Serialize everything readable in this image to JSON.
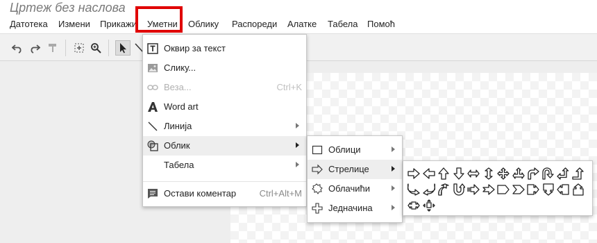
{
  "doc_title": "Цртеж без наслова",
  "menubar": [
    "Датотека",
    "Измени",
    "Прикажи",
    "Уметни",
    "Облику",
    "Распореди",
    "Алатке",
    "Табела",
    "Помоћ"
  ],
  "insert_menu": {
    "text_box": "Оквир за текст",
    "image": "Слику...",
    "link": "Веза...",
    "link_shortcut": "Ctrl+K",
    "word_art": "Word art",
    "line": "Линија",
    "shape": "Облик",
    "table": "Табела",
    "comment": "Остави коментар",
    "comment_shortcut": "Ctrl+Alt+M"
  },
  "shape_submenu": {
    "shapes": "Облици",
    "arrows": "Стрелице",
    "callouts": "Облачићи",
    "equations": "Једначина"
  },
  "arrow_shapes": [
    "right-arrow-icon",
    "left-arrow-icon",
    "up-arrow-icon",
    "down-arrow-icon",
    "left-right-arrow-icon",
    "up-down-arrow-icon",
    "quad-arrow-icon",
    "left-right-up-arrow-icon",
    "bent-arrow-icon",
    "u-turn-arrow-icon",
    "left-up-arrow-icon",
    "bent-up-arrow-icon",
    "curved-right-arrow-icon",
    "curved-left-arrow-icon",
    "curved-up-arrow-icon",
    "curved-down-arrow-icon",
    "striped-right-arrow-icon",
    "notched-right-arrow-icon",
    "pentagon-arrow-icon",
    "chevron-arrow-icon",
    "right-arrow-callout-icon",
    "down-arrow-callout-icon",
    "left-arrow-callout-icon",
    "up-arrow-callout-icon",
    "left-right-arrow-callout-icon",
    "quad-arrow-callout-icon"
  ],
  "colors": {
    "highlight": "#e00000",
    "menu_hover": "#eeeeee"
  }
}
